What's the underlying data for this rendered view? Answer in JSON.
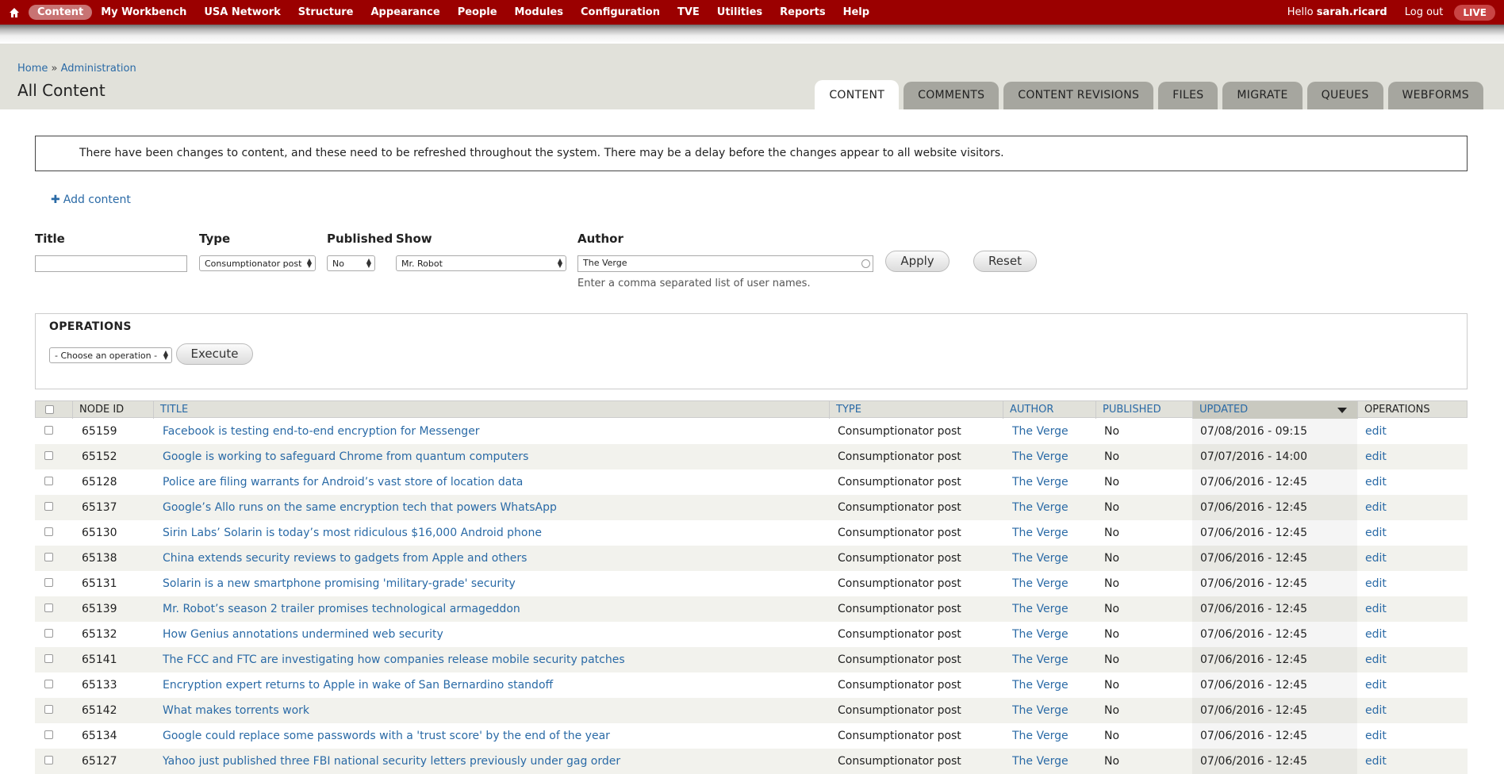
{
  "topbar": {
    "nav": [
      "Content",
      "My Workbench",
      "USA Network",
      "Structure",
      "Appearance",
      "People",
      "Modules",
      "Configuration",
      "TVE",
      "Utilities",
      "Reports",
      "Help"
    ],
    "hello_prefix": "Hello ",
    "username": "sarah.ricard",
    "logout": "Log out",
    "live": "LIVE"
  },
  "breadcrumb": {
    "home": "Home",
    "sep": " » ",
    "admin": "Administration"
  },
  "page_title": "All Content",
  "tabs": [
    "CONTENT",
    "COMMENTS",
    "CONTENT REVISIONS",
    "FILES",
    "MIGRATE",
    "QUEUES",
    "WEBFORMS"
  ],
  "message": "There have been changes to content, and these need to be refreshed throughout the system. There may be a delay before the changes appear to all website visitors.",
  "add_content": "Add content",
  "filters": {
    "title_label": "Title",
    "title_value": "",
    "type_label": "Type",
    "type_value": "Consumptionator post",
    "published_label": "Published",
    "published_value": "No",
    "show_label": "Show",
    "show_value": "Mr. Robot",
    "author_label": "Author",
    "author_value": "The Verge",
    "author_hint": "Enter a comma separated list of user names.",
    "apply": "Apply",
    "reset": "Reset"
  },
  "operations": {
    "title": "OPERATIONS",
    "select_value": "- Choose an operation -",
    "execute": "Execute"
  },
  "table": {
    "headers": {
      "node_id": "NODE ID",
      "title": "TITLE",
      "type": "TYPE",
      "author": "AUTHOR",
      "published": "PUBLISHED",
      "updated": "UPDATED",
      "operations": "OPERATIONS"
    },
    "rows": [
      {
        "id": "65159",
        "title": "Facebook is testing end-to-end encryption for Messenger",
        "type": "Consumptionator post",
        "author": "The Verge",
        "published": "No",
        "updated": "07/08/2016 - 09:15",
        "op": "edit"
      },
      {
        "id": "65152",
        "title": "Google is working to safeguard Chrome from quantum computers",
        "type": "Consumptionator post",
        "author": "The Verge",
        "published": "No",
        "updated": "07/07/2016 - 14:00",
        "op": "edit"
      },
      {
        "id": "65128",
        "title": "Police are filing warrants for Android’s vast store of location data",
        "type": "Consumptionator post",
        "author": "The Verge",
        "published": "No",
        "updated": "07/06/2016 - 12:45",
        "op": "edit"
      },
      {
        "id": "65137",
        "title": "Google’s Allo runs on the same encryption tech that powers WhatsApp",
        "type": "Consumptionator post",
        "author": "The Verge",
        "published": "No",
        "updated": "07/06/2016 - 12:45",
        "op": "edit"
      },
      {
        "id": "65130",
        "title": "Sirin Labs’ Solarin is today’s most ridiculous $16,000 Android phone",
        "type": "Consumptionator post",
        "author": "The Verge",
        "published": "No",
        "updated": "07/06/2016 - 12:45",
        "op": "edit"
      },
      {
        "id": "65138",
        "title": "China extends security reviews to gadgets from Apple and others",
        "type": "Consumptionator post",
        "author": "The Verge",
        "published": "No",
        "updated": "07/06/2016 - 12:45",
        "op": "edit"
      },
      {
        "id": "65131",
        "title": "Solarin is a new smartphone promising 'military-grade' security",
        "type": "Consumptionator post",
        "author": "The Verge",
        "published": "No",
        "updated": "07/06/2016 - 12:45",
        "op": "edit"
      },
      {
        "id": "65139",
        "title": "Mr. Robot’s season 2 trailer promises technological armageddon",
        "type": "Consumptionator post",
        "author": "The Verge",
        "published": "No",
        "updated": "07/06/2016 - 12:45",
        "op": "edit"
      },
      {
        "id": "65132",
        "title": "How Genius annotations undermined web security",
        "type": "Consumptionator post",
        "author": "The Verge",
        "published": "No",
        "updated": "07/06/2016 - 12:45",
        "op": "edit"
      },
      {
        "id": "65141",
        "title": "The FCC and FTC are investigating how companies release mobile security patches",
        "type": "Consumptionator post",
        "author": "The Verge",
        "published": "No",
        "updated": "07/06/2016 - 12:45",
        "op": "edit"
      },
      {
        "id": "65133",
        "title": "Encryption expert returns to Apple in wake of San Bernardino standoff",
        "type": "Consumptionator post",
        "author": "The Verge",
        "published": "No",
        "updated": "07/06/2016 - 12:45",
        "op": "edit"
      },
      {
        "id": "65142",
        "title": "What makes torrents work",
        "type": "Consumptionator post",
        "author": "The Verge",
        "published": "No",
        "updated": "07/06/2016 - 12:45",
        "op": "edit"
      },
      {
        "id": "65134",
        "title": "Google could replace some passwords with a 'trust score' by the end of the year",
        "type": "Consumptionator post",
        "author": "The Verge",
        "published": "No",
        "updated": "07/06/2016 - 12:45",
        "op": "edit"
      },
      {
        "id": "65127",
        "title": "Yahoo just published three FBI national security letters previously under gag order",
        "type": "Consumptionator post",
        "author": "The Verge",
        "published": "No",
        "updated": "07/06/2016 - 12:45",
        "op": "edit"
      }
    ]
  },
  "colors": {
    "topbar": "#9b0000",
    "link": "#2a6aa6",
    "header_bg": "#e1e1da"
  }
}
